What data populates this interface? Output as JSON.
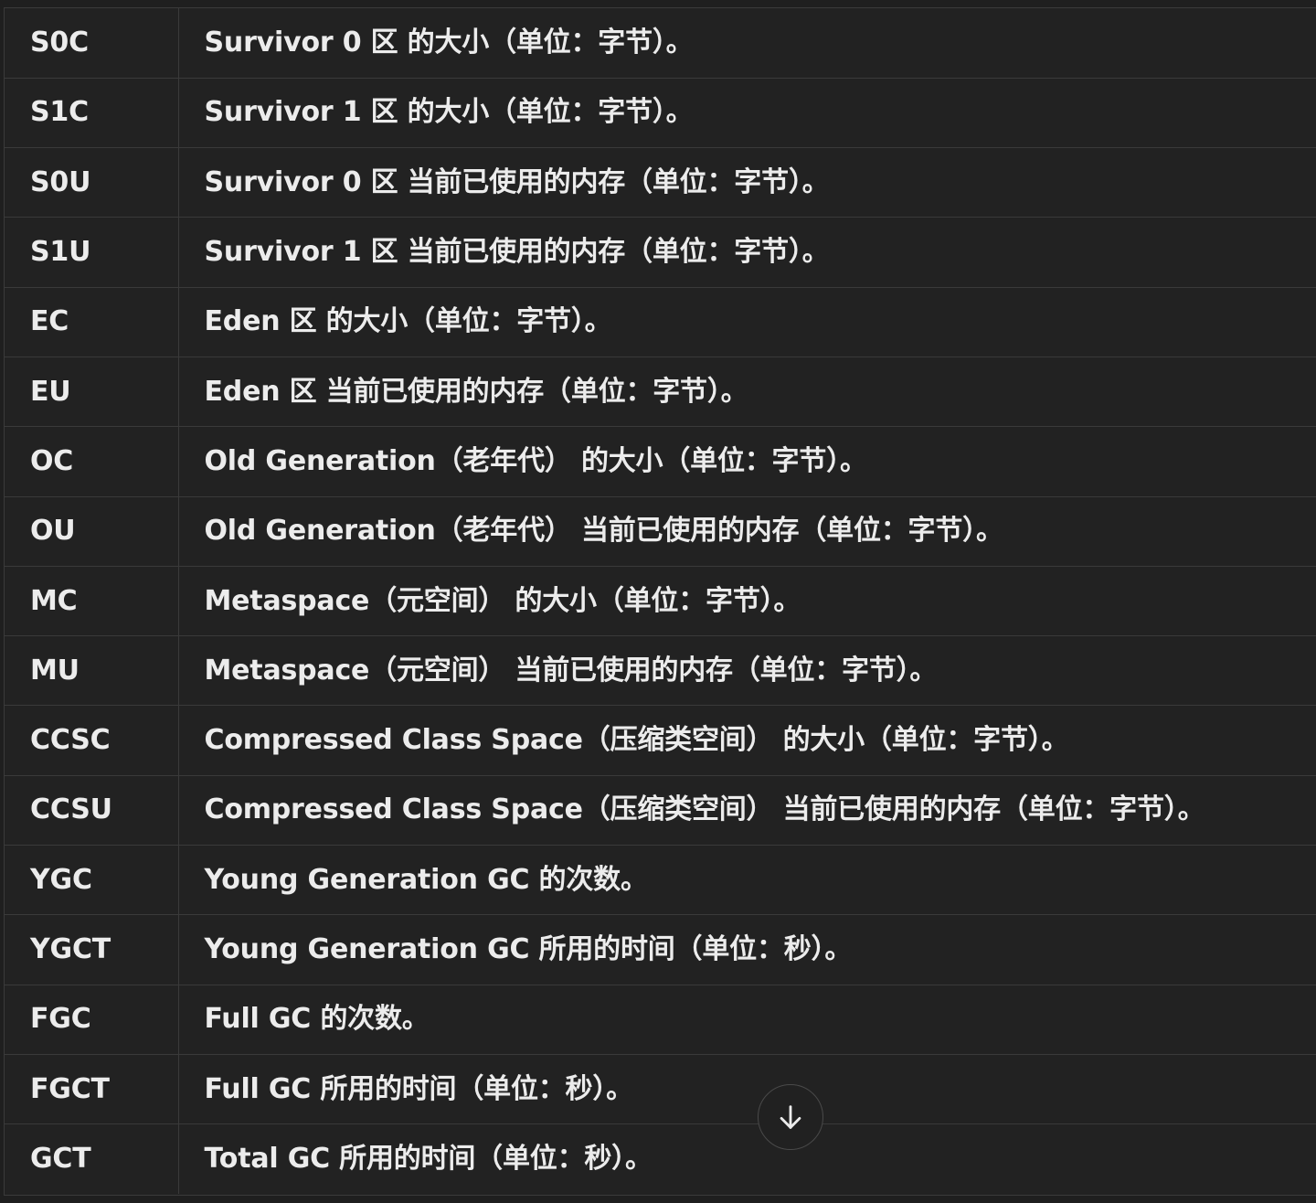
{
  "rows": [
    {
      "key": "S0C",
      "desc": "Survivor 0 区 的大小（单位：字节）。"
    },
    {
      "key": "S1C",
      "desc": "Survivor 1 区 的大小（单位：字节）。"
    },
    {
      "key": "S0U",
      "desc": "Survivor 0 区 当前已使用的内存（单位：字节）。"
    },
    {
      "key": "S1U",
      "desc": "Survivor 1 区 当前已使用的内存（单位：字节）。"
    },
    {
      "key": "EC",
      "desc": "Eden 区 的大小（单位：字节）。"
    },
    {
      "key": "EU",
      "desc": "Eden 区 当前已使用的内存（单位：字节）。"
    },
    {
      "key": "OC",
      "desc": "Old Generation（老年代） 的大小（单位：字节）。"
    },
    {
      "key": "OU",
      "desc": "Old Generation（老年代） 当前已使用的内存（单位：字节）。"
    },
    {
      "key": "MC",
      "desc": "Metaspace（元空间） 的大小（单位：字节）。"
    },
    {
      "key": "MU",
      "desc": "Metaspace（元空间） 当前已使用的内存（单位：字节）。"
    },
    {
      "key": "CCSC",
      "desc": "Compressed Class Space（压缩类空间） 的大小（单位：字节）。"
    },
    {
      "key": "CCSU",
      "desc": "Compressed Class Space（压缩类空间） 当前已使用的内存（单位：字节）。"
    },
    {
      "key": "YGC",
      "desc": "Young Generation GC 的次数。"
    },
    {
      "key": "YGCT",
      "desc": "Young Generation GC 所用的时间（单位：秒）。"
    },
    {
      "key": "FGC",
      "desc": "Full GC 的次数。"
    },
    {
      "key": "FGCT",
      "desc": "Full GC 所用的时间（单位：秒）。"
    },
    {
      "key": "GCT",
      "desc": "Total GC 所用的时间（单位：秒）。"
    }
  ],
  "scroll_button": {
    "icon": "arrow-down-icon"
  },
  "colors": {
    "background": "#222222",
    "text": "#ececec",
    "border": "#3a3a3a"
  }
}
